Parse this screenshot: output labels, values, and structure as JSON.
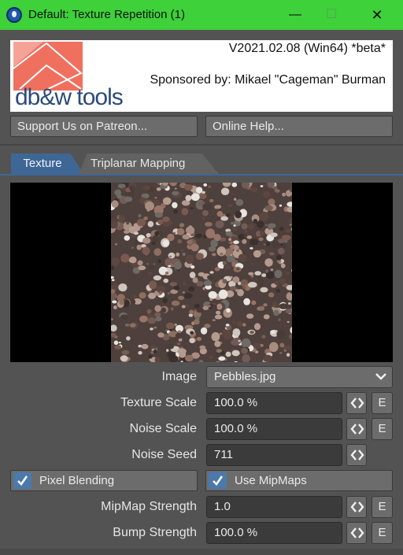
{
  "window": {
    "title": "Default: Texture Repetition (1)",
    "minimize_glyph": "—",
    "maximize_glyph": "☐",
    "close_glyph": "✕",
    "titlebar_color": "#3ed13a"
  },
  "header": {
    "logo_text": "db&w tools",
    "version": "V2021.02.08 (Win64) *beta*",
    "sponsor": "Sponsored by: Mikael \"Cageman\" Burman"
  },
  "links": {
    "patreon_label": "Support Us on Patreon...",
    "help_label": "Online Help..."
  },
  "tabs": [
    {
      "label": "Texture",
      "active": true
    },
    {
      "label": "Triplanar Mapping",
      "active": false
    }
  ],
  "image": {
    "label": "Image",
    "value": "Pebbles.jpg"
  },
  "params": {
    "texture_scale": {
      "label": "Texture Scale",
      "value": "100.0 %",
      "edit": "E"
    },
    "noise_scale": {
      "label": "Noise Scale",
      "value": "100.0 %",
      "edit": "E"
    },
    "noise_seed": {
      "label": "Noise Seed",
      "value": "711"
    },
    "mipmap_strength": {
      "label": "MipMap Strength",
      "value": "1.0",
      "edit": "E"
    },
    "bump_strength": {
      "label": "Bump Strength",
      "value": "100.0 %",
      "edit": "E"
    }
  },
  "options": {
    "pixel_blending": {
      "label": "Pixel Blending",
      "checked": true
    },
    "use_mipmaps": {
      "label": "Use MipMaps",
      "checked": true
    }
  },
  "colors": {
    "accent": "#3f6796",
    "checkbox": "#4b79ad",
    "panel": "#535353"
  }
}
